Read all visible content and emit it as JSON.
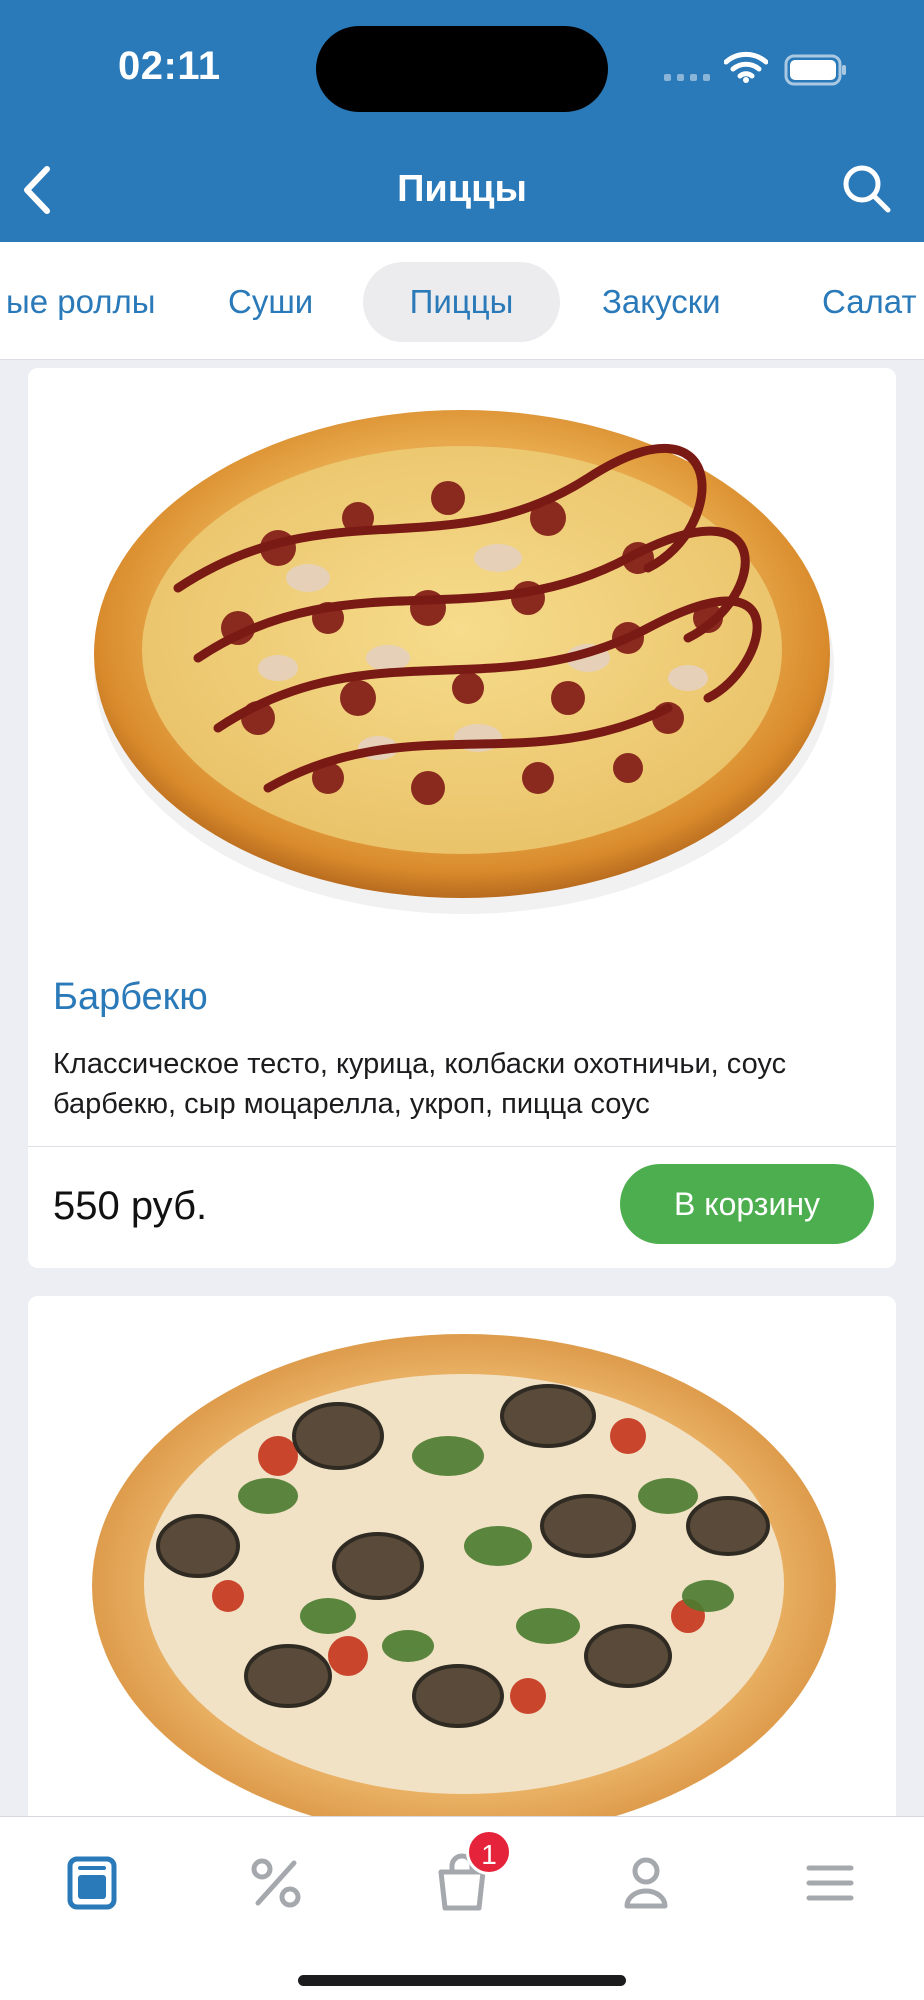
{
  "status": {
    "time": "02:11"
  },
  "header": {
    "title": "Пиццы"
  },
  "tabs": [
    {
      "label": "ые роллы"
    },
    {
      "label": "Суши"
    },
    {
      "label": "Пиццы",
      "active": true
    },
    {
      "label": "Закуски"
    },
    {
      "label": "Салат"
    }
  ],
  "products": [
    {
      "name": "Барбекю",
      "description": "Классическое тесто, курица, колбаски охотничьи, соус барбекю, сыр моцарелла, укроп, пицца соус",
      "price": "550 руб.",
      "button_label": "В корзину",
      "image_icon": "pizza-bbq-image"
    },
    {
      "image_icon": "pizza-vegetable-image"
    }
  ],
  "tabbar": {
    "items": [
      {
        "icon": "menu-book-icon",
        "active": true
      },
      {
        "icon": "percent-icon"
      },
      {
        "icon": "shopping-bag-icon"
      },
      {
        "icon": "profile-icon"
      },
      {
        "icon": "hamburger-menu-icon"
      }
    ],
    "cart_badge": "1"
  },
  "colors": {
    "primary": "#2a79b8",
    "cart_button": "#4cae4f",
    "badge": "#e5243b",
    "background": "#eceef3"
  }
}
